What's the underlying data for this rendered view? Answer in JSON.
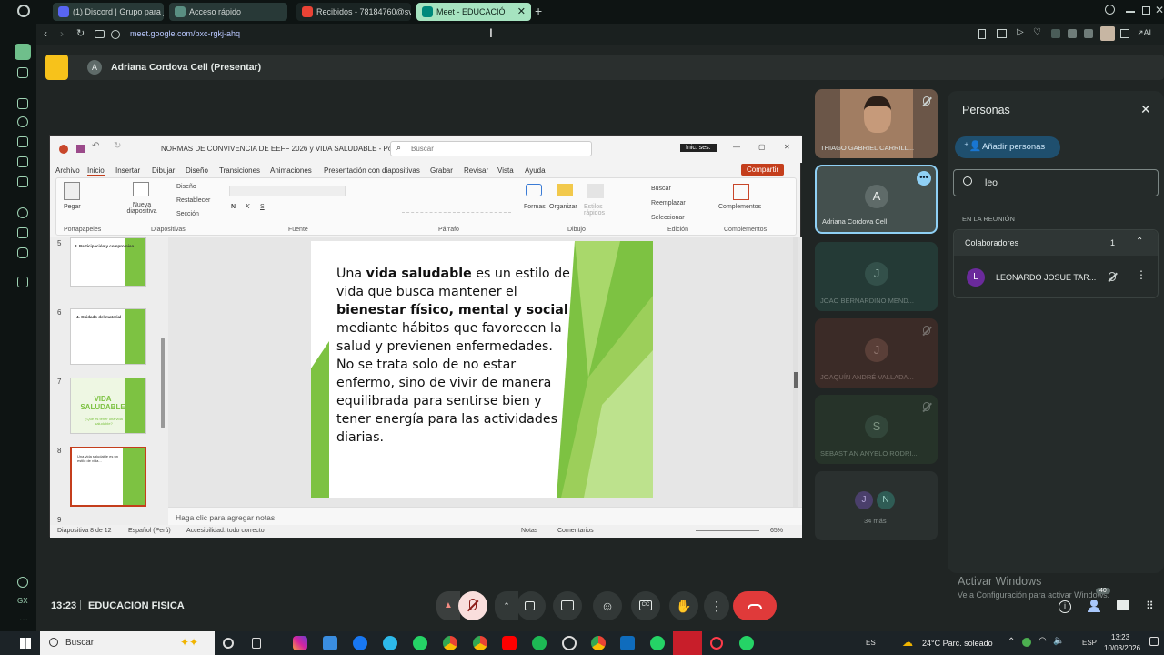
{
  "browser": {
    "tabs": [
      {
        "label": "(1) Discord | Grupo para ju"
      },
      {
        "label": "Acceso rápido"
      },
      {
        "label": "Recibidos - 78184760@sv"
      },
      {
        "label": "Meet - EDUCACIÓ"
      }
    ],
    "url": "meet.google.com/bxc-rgkj-ahq"
  },
  "presenter": {
    "initial": "A",
    "label": "Adriana Cordova Cell (Presentar)"
  },
  "powerpoint": {
    "title": "NORMAS DE CONVIVENCIA DE EEFF 2026 y VIDA SALUDABLE  -  PowerP...",
    "search_placeholder": "Buscar",
    "signin": "Inic. ses.",
    "menu": [
      "Archivo",
      "Inicio",
      "Insertar",
      "Dibujar",
      "Diseño",
      "Transiciones",
      "Animaciones",
      "Presentación con diapositivas",
      "Grabar",
      "Revisar",
      "Vista",
      "Ayuda"
    ],
    "share": "Compartir",
    "ribbon": {
      "paste": "Pegar",
      "new_slide": "Nueva diapositiva",
      "design": "Diseño",
      "reset": "Restablecer",
      "section": "Sección",
      "shapes": "Formas",
      "arrange": "Organizar",
      "quick_styles": "Estilos rápidos",
      "find": "Buscar",
      "replace": "Reemplazar",
      "select": "Seleccionar",
      "addins": "Complementos",
      "groups": [
        "Portapapeles",
        "Diapositivas",
        "Fuente",
        "Párrafo",
        "Dibujo",
        "Edición",
        "Complementos"
      ]
    },
    "thumbnails": [
      {
        "num": "5",
        "title": "3. Participación y compromiso"
      },
      {
        "num": "6",
        "title": "4. Cuidado del material"
      },
      {
        "num": "7",
        "title": "VIDA SALUDABLE",
        "subtitle": "¿Qué es tener una vida saludable?"
      },
      {
        "num": "8",
        "title": "Una vida saludable es un estilo de vida..."
      },
      {
        "num": "9",
        "title": ""
      }
    ],
    "slide": {
      "p1": "Una ",
      "b1": "vida saludable",
      "p2": " es un estilo de vida que busca mantener el ",
      "b2": "bienestar físico, mental y social",
      "p3": " mediante hábitos que favorecen la salud y previenen enfermedades. No se trata solo de no estar enfermo, sino de vivir de manera equilibrada para sentirse bien y tener energía para las actividades diarias."
    },
    "notes_placeholder": "Haga clic para agregar notas",
    "status": {
      "slide_count": "Diapositiva 8 de 12",
      "language": "Español (Perú)",
      "accessibility": "Accesibilidad: todo correcto",
      "notes": "Notas",
      "comments": "Comentarios",
      "zoom": "65%"
    }
  },
  "participants": [
    {
      "name": "THIAGO GABRIEL CARRILL...",
      "type": "video"
    },
    {
      "name": "Adriana Cordova Cell",
      "initial": "A",
      "color": "#5f6b69",
      "active": true
    },
    {
      "name": "JOAO BERNARDINO MEND...",
      "initial": "J",
      "color": "#33504a"
    },
    {
      "name": "JOAQUÍN ANDRÉ VALLADA...",
      "initial": "J",
      "color": "#5a3f38"
    },
    {
      "name": "SEBASTIAN ANYELO RODRI...",
      "initial": "S",
      "color": "#32463a"
    },
    {
      "more": "34 más",
      "initials": [
        "J",
        "N"
      ]
    }
  ],
  "people_panel": {
    "title": "Personas",
    "add_people": "Añadir personas",
    "search_value": "leo",
    "section": "EN LA REUNIÓN",
    "group": "Colaboradores",
    "group_count": "1",
    "member_initial": "L",
    "member_name": "LEONARDO JOSUE TAR..."
  },
  "meeting": {
    "time": "13:23",
    "name": "EDUCACION FISICA",
    "badge": "40"
  },
  "windows": {
    "activate_title": "Activar Windows",
    "activate_sub": "Ve a Configuración para activar Windows.",
    "search": "Buscar",
    "lang": "ES",
    "weather": "24°C  Parc. soleado",
    "kbd": "ESP",
    "clock_time": "13:23",
    "clock_date": "10/03/2026"
  },
  "colors": {
    "accent_green": "#a6e3c0",
    "hangup_red": "#e03a3a",
    "active_border": "#8fd0f5",
    "slide_green": "#7dc242"
  }
}
